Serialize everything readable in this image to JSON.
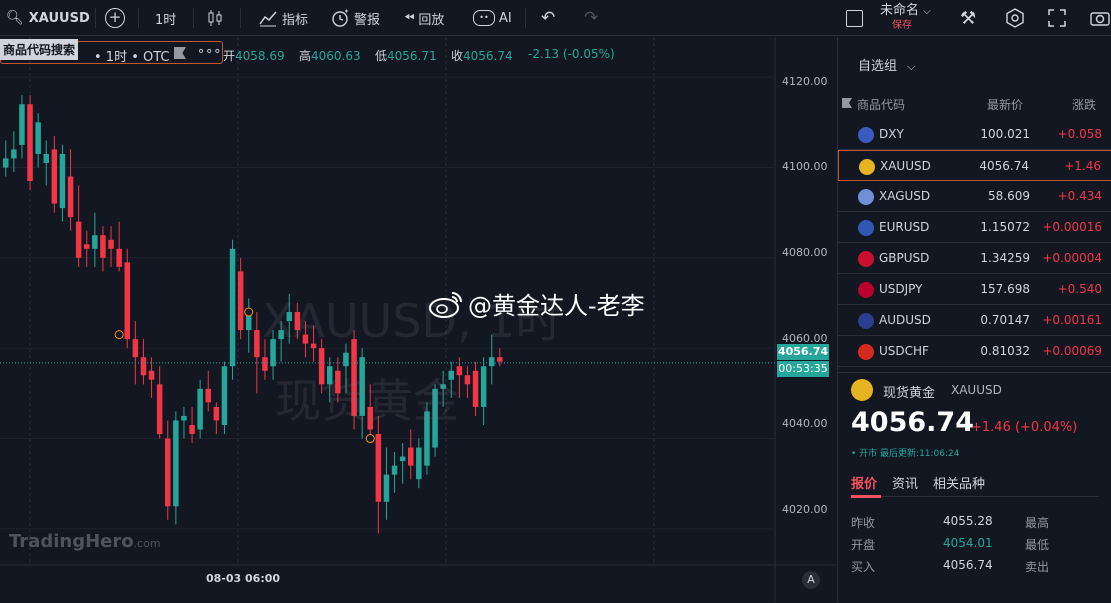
{
  "toolbar": {
    "symbol": "XAUUSD",
    "interval": "1时",
    "indicators": "指标",
    "alert": "警报",
    "replay": "回放",
    "ai": "AI",
    "layout_name": "未命名",
    "save": "保存"
  },
  "chart": {
    "tooltip": "商品代码搜索",
    "legend_meta": "• 1时 • OTC",
    "dots": "∘∘∘",
    "open_label": "开",
    "open": "4058.69",
    "high_label": "高",
    "high": "4060.63",
    "low_label": "低",
    "low": "4056.71",
    "close_label": "收",
    "close": "4056.74",
    "change": "-2.13 (-0.05%)",
    "watermark_symbol": "XAUUSD, 1时",
    "watermark_name": "现货黄金",
    "overlay_text": "@黄金达人-老李",
    "brand": "TradingHero",
    "brand_suffix": ".com",
    "y_axis": [
      "4120.00",
      "4100.00",
      "4080.00",
      "4060.00",
      "4040.00",
      "4020.00"
    ],
    "current_price": "4056.74",
    "countdown": "00:53:35",
    "x_label": "08-03 06:00",
    "auto_btn": "A",
    "colors": {
      "up": "#26a69a",
      "down": "#f23645",
      "bg": "#131722"
    }
  },
  "chart_data": {
    "type": "candlestick",
    "ylim": [
      4012,
      4128
    ],
    "candles": [
      {
        "o": 4100,
        "h": 4106,
        "l": 4098,
        "c": 4102
      },
      {
        "o": 4102,
        "h": 4108,
        "l": 4099,
        "c": 4104
      },
      {
        "o": 4105,
        "h": 4116,
        "l": 4102,
        "c": 4114
      },
      {
        "o": 4114,
        "h": 4116,
        "l": 4095,
        "c": 4097
      },
      {
        "o": 4103,
        "h": 4112,
        "l": 4100,
        "c": 4110
      },
      {
        "o": 4101,
        "h": 4106,
        "l": 4096,
        "c": 4103
      },
      {
        "o": 4104,
        "h": 4107,
        "l": 4090,
        "c": 4092
      },
      {
        "o": 4091,
        "h": 4105,
        "l": 4088,
        "c": 4103
      },
      {
        "o": 4098,
        "h": 4104,
        "l": 4086,
        "c": 4089
      },
      {
        "o": 4088,
        "h": 4096,
        "l": 4078,
        "c": 4080
      },
      {
        "o": 4083,
        "h": 4086,
        "l": 4078,
        "c": 4082
      },
      {
        "o": 4082,
        "h": 4090,
        "l": 4078,
        "c": 4085
      },
      {
        "o": 4085,
        "h": 4087,
        "l": 4077,
        "c": 4080
      },
      {
        "o": 4084,
        "h": 4087,
        "l": 4078,
        "c": 4082
      },
      {
        "o": 4082,
        "h": 4088,
        "l": 4077,
        "c": 4078
      },
      {
        "o": 4079,
        "h": 4082,
        "l": 4060,
        "c": 4062
      },
      {
        "o": 4062,
        "h": 4066,
        "l": 4052,
        "c": 4058
      },
      {
        "o": 4058,
        "h": 4062,
        "l": 4052,
        "c": 4054
      },
      {
        "o": 4055,
        "h": 4058,
        "l": 4049,
        "c": 4053
      },
      {
        "o": 4052,
        "h": 4056,
        "l": 4040,
        "c": 4041
      },
      {
        "o": 4040,
        "h": 4044,
        "l": 4022,
        "c": 4025
      },
      {
        "o": 4025,
        "h": 4046,
        "l": 4021,
        "c": 4044
      },
      {
        "o": 4044,
        "h": 4047,
        "l": 4040,
        "c": 4045
      },
      {
        "o": 4043,
        "h": 4047,
        "l": 4039,
        "c": 4041
      },
      {
        "o": 4042,
        "h": 4053,
        "l": 4040,
        "c": 4051
      },
      {
        "o": 4051,
        "h": 4055,
        "l": 4046,
        "c": 4048
      },
      {
        "o": 4047,
        "h": 4048,
        "l": 4041,
        "c": 4044
      },
      {
        "o": 4043,
        "h": 4057,
        "l": 4041,
        "c": 4056
      },
      {
        "o": 4056,
        "h": 4084,
        "l": 4053,
        "c": 4082
      },
      {
        "o": 4077,
        "h": 4080,
        "l": 4062,
        "c": 4064
      },
      {
        "o": 4064,
        "h": 4071,
        "l": 4059,
        "c": 4068
      },
      {
        "o": 4064,
        "h": 4068,
        "l": 4050,
        "c": 4058
      },
      {
        "o": 4058,
        "h": 4062,
        "l": 4053,
        "c": 4055
      },
      {
        "o": 4056,
        "h": 4064,
        "l": 4053,
        "c": 4062
      },
      {
        "o": 4062,
        "h": 4066,
        "l": 4057,
        "c": 4064
      },
      {
        "o": 4066,
        "h": 4072,
        "l": 4061,
        "c": 4068
      },
      {
        "o": 4068,
        "h": 4070,
        "l": 4062,
        "c": 4064
      },
      {
        "o": 4063,
        "h": 4066,
        "l": 4058,
        "c": 4061
      },
      {
        "o": 4061,
        "h": 4065,
        "l": 4057,
        "c": 4060
      },
      {
        "o": 4060,
        "h": 4062,
        "l": 4050,
        "c": 4052
      },
      {
        "o": 4052,
        "h": 4058,
        "l": 4048,
        "c": 4056
      },
      {
        "o": 4055,
        "h": 4058,
        "l": 4048,
        "c": 4050
      },
      {
        "o": 4056,
        "h": 4061,
        "l": 4050,
        "c": 4059
      },
      {
        "o": 4062,
        "h": 4064,
        "l": 4042,
        "c": 4045
      },
      {
        "o": 4045,
        "h": 4060,
        "l": 4040,
        "c": 4058
      },
      {
        "o": 4047,
        "h": 4052,
        "l": 4040,
        "c": 4042
      },
      {
        "o": 4041,
        "h": 4045,
        "l": 4019,
        "c": 4026
      },
      {
        "o": 4026,
        "h": 4038,
        "l": 4022,
        "c": 4032
      },
      {
        "o": 4032,
        "h": 4037,
        "l": 4028,
        "c": 4034
      },
      {
        "o": 4035,
        "h": 4039,
        "l": 4030,
        "c": 4036
      },
      {
        "o": 4038,
        "h": 4042,
        "l": 4031,
        "c": 4034
      },
      {
        "o": 4031,
        "h": 4040,
        "l": 4029,
        "c": 4038
      },
      {
        "o": 4034,
        "h": 4048,
        "l": 4032,
        "c": 4046
      },
      {
        "o": 4038,
        "h": 4052,
        "l": 4036,
        "c": 4051
      },
      {
        "o": 4051,
        "h": 4055,
        "l": 4047,
        "c": 4052
      },
      {
        "o": 4053,
        "h": 4057,
        "l": 4049,
        "c": 4055
      },
      {
        "o": 4056,
        "h": 4058,
        "l": 4049,
        "c": 4054
      },
      {
        "o": 4054,
        "h": 4056,
        "l": 4049,
        "c": 4052
      },
      {
        "o": 4055,
        "h": 4057,
        "l": 4045,
        "c": 4047
      },
      {
        "o": 4047,
        "h": 4058,
        "l": 4043,
        "c": 4056
      },
      {
        "o": 4056,
        "h": 4063,
        "l": 4052,
        "c": 4058
      },
      {
        "o": 4058,
        "h": 4060,
        "l": 4056,
        "c": 4057
      }
    ]
  },
  "watchlist": {
    "title": "自选组",
    "col_symbol": "商品代码",
    "col_price": "最新价",
    "col_change": "涨跌",
    "items": [
      {
        "symbol": "DXY",
        "price": "100.021",
        "change": "+0.058",
        "flag": "#3c5bbf"
      },
      {
        "symbol": "XAUUSD",
        "price": "4056.74",
        "change": "+1.46",
        "flag": "#e6b422"
      },
      {
        "symbol": "XAGUSD",
        "price": "58.609",
        "change": "+0.434",
        "flag": "#6f8fd9"
      },
      {
        "symbol": "EURUSD",
        "price": "1.15072",
        "change": "+0.00016",
        "flag": "#2f57b3"
      },
      {
        "symbol": "GBPUSD",
        "price": "1.34259",
        "change": "+0.00004",
        "flag": "#c8102e"
      },
      {
        "symbol": "USDJPY",
        "price": "157.698",
        "change": "+0.540",
        "flag": "#bc002d"
      },
      {
        "symbol": "AUDUSD",
        "price": "0.70147",
        "change": "+0.00161",
        "flag": "#2a3d8f"
      },
      {
        "symbol": "USDCHF",
        "price": "0.81032",
        "change": "+0.00069",
        "flag": "#d52b1e"
      }
    ]
  },
  "detail": {
    "name": "现货黄金",
    "symbol": "XAUUSD",
    "price": "4056.74",
    "change": "+1.46 (+0.04%)",
    "status": "• 开市 最后更新:11:06:24",
    "tabs": [
      "报价",
      "资讯",
      "相关品种"
    ],
    "rows": [
      {
        "label": "昨收",
        "value": "4055.28",
        "label2": "最高"
      },
      {
        "label": "开盘",
        "value": "4054.01",
        "label2": "最低"
      },
      {
        "label": "买入",
        "value": "4056.74",
        "label2": "卖出"
      }
    ]
  }
}
